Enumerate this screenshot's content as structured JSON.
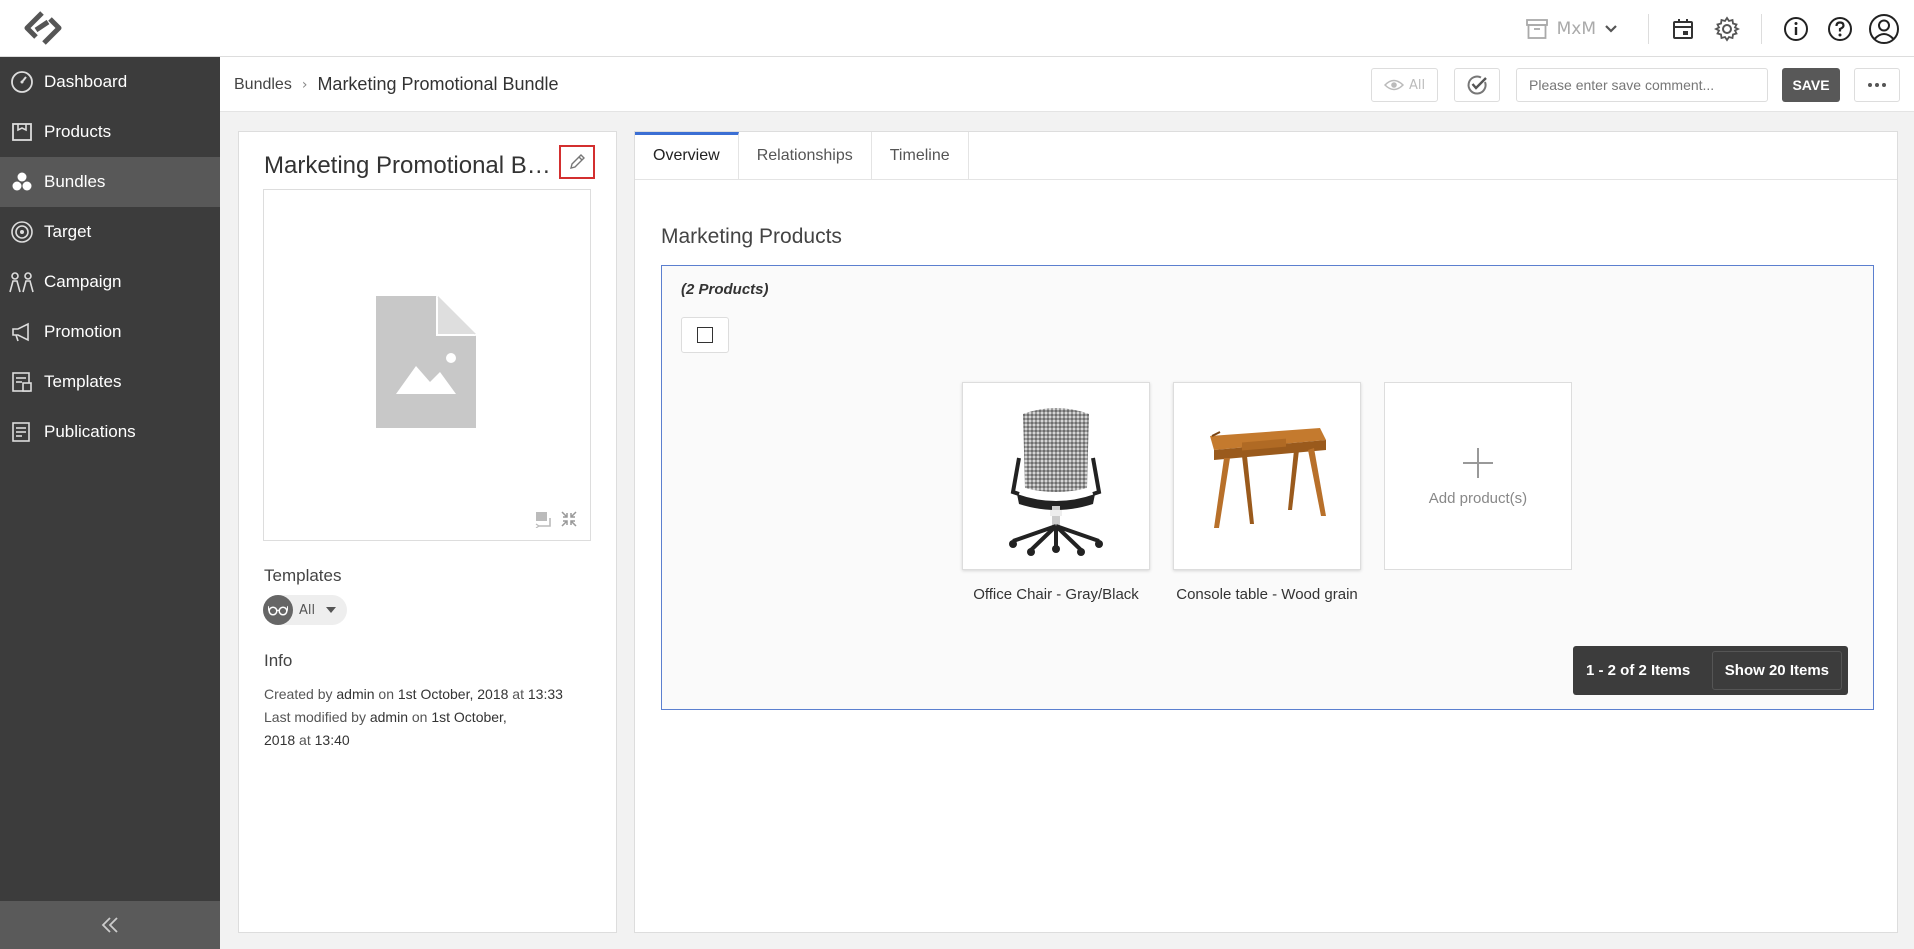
{
  "colors": {
    "sidebar_bg": "#3c3c3c",
    "sidebar_active": "#585858",
    "accent": "#3b6fd4",
    "highlight_border": "#d32f2f",
    "save_button_bg": "#585858"
  },
  "topbar": {
    "workspace_label": "MxM",
    "icons": [
      "workspace-archive-icon",
      "calendar-icon",
      "gear-icon",
      "info-icon",
      "help-icon",
      "user-icon"
    ]
  },
  "sidebar": {
    "items": [
      {
        "label": "Dashboard",
        "icon": "dashboard-icon"
      },
      {
        "label": "Products",
        "icon": "products-icon"
      },
      {
        "label": "Bundles",
        "icon": "bundles-icon",
        "active": true
      },
      {
        "label": "Target",
        "icon": "target-icon"
      },
      {
        "label": "Campaign",
        "icon": "campaign-icon"
      },
      {
        "label": "Promotion",
        "icon": "promotion-icon"
      },
      {
        "label": "Templates",
        "icon": "templates-icon"
      },
      {
        "label": "Publications",
        "icon": "publications-icon"
      }
    ],
    "collapse_icon": "double-chevron-left-icon"
  },
  "breadcrumb": {
    "parent": "Bundles",
    "separator": "›",
    "current": "Marketing Promotional Bundle"
  },
  "actions": {
    "view_label": "All",
    "comment_placeholder": "Please enter save comment...",
    "save_label": "SAVE"
  },
  "details": {
    "title": "Marketing Promotional Bundle",
    "templates_heading": "Templates",
    "templates_filter": "All",
    "info_heading": "Info",
    "info": {
      "created_prefix": "Created by",
      "created_user": "admin",
      "created_on": "on",
      "created_date": "1st October, 2018",
      "created_at": "at",
      "created_time": "13:33",
      "modified_prefix": "Last modified by",
      "modified_user": "admin",
      "modified_on": "on",
      "modified_date_part1": "1st October,",
      "modified_date_part2": "2018",
      "modified_at": "at",
      "modified_time": "13:40"
    }
  },
  "tabs": [
    {
      "label": "Overview",
      "active": true
    },
    {
      "label": "Relationships"
    },
    {
      "label": "Timeline"
    }
  ],
  "marketing": {
    "title": "Marketing Products",
    "count_label": "(2 Products)",
    "products": [
      {
        "name": "Office Chair - Gray/Black"
      },
      {
        "name": "Console table - Wood grain"
      }
    ],
    "add_label": "Add product(s)",
    "pager_count": "1 - 2 of 2 Items",
    "pager_show": "Show 20 Items"
  }
}
